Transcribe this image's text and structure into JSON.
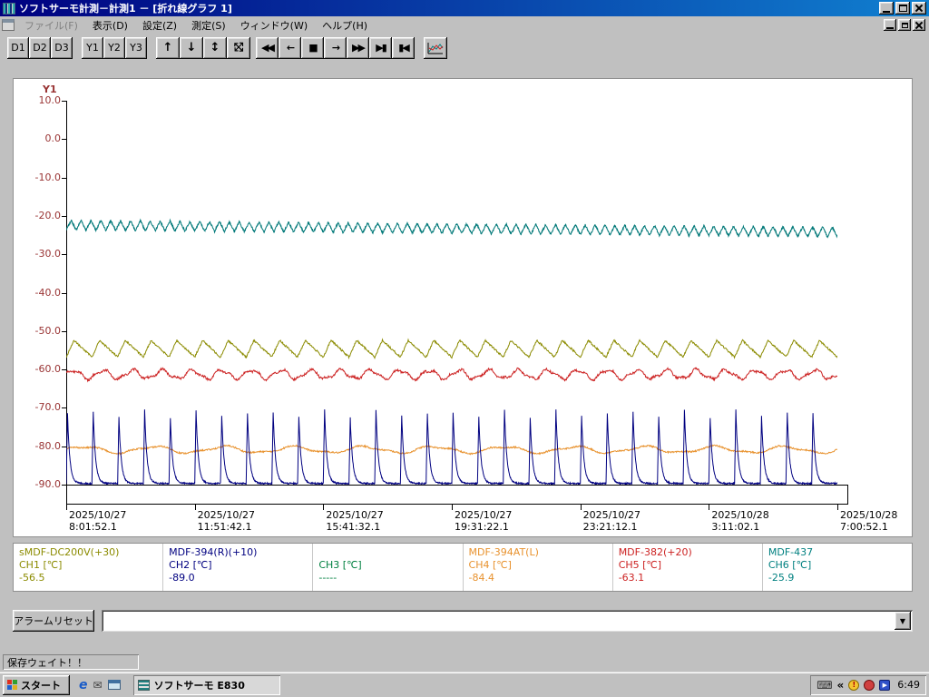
{
  "window": {
    "title": "ソフトサーモ計測－計測1 － [折れ線グラフ 1]"
  },
  "menu": {
    "items": [
      {
        "label": "ファイル(F)",
        "disabled": true
      },
      {
        "label": "表示(D)",
        "disabled": false
      },
      {
        "label": "設定(Z)",
        "disabled": false
      },
      {
        "label": "測定(S)",
        "disabled": false
      },
      {
        "label": "ウィンドウ(W)",
        "disabled": false
      },
      {
        "label": "ヘルプ(H)",
        "disabled": false
      }
    ]
  },
  "toolbar": {
    "d_buttons": [
      "D1",
      "D2",
      "D3"
    ],
    "y_buttons": [
      "Y1",
      "Y2",
      "Y3"
    ],
    "arrow_buttons": [
      {
        "name": "scroll-up-button",
        "glyph": "↑"
      },
      {
        "name": "scroll-down-button",
        "glyph": "↓"
      },
      {
        "name": "fit-vertical-button",
        "glyph": "↕"
      },
      {
        "name": "fit-all-button",
        "glyph": [
          "⤡",
          "⤢"
        ]
      }
    ],
    "media_buttons": [
      {
        "name": "rewind-button",
        "glyph": "◀◀"
      },
      {
        "name": "step-back-button",
        "glyph": "←"
      },
      {
        "name": "stop-button",
        "glyph": "■"
      },
      {
        "name": "step-forward-button",
        "glyph": "→"
      },
      {
        "name": "fast-forward-button",
        "glyph": "▶▶"
      },
      {
        "name": "skip-to-end-button",
        "glyph": "▶▮"
      },
      {
        "name": "skip-to-start-button",
        "glyph": "▮◀"
      }
    ]
  },
  "icons": {
    "dropdown_arrow": "▼",
    "tray_chevron": "«",
    "ie": "e",
    "mail": "✉",
    "keyboard": "⌨",
    "player_play": "▶",
    "warning": "!"
  },
  "chart_data": {
    "type": "line",
    "axis_label": "Y1",
    "ylim": [
      -90,
      10
    ],
    "yticks": [
      "10.0",
      "0.0",
      "-10.0",
      "-20.0",
      "-30.0",
      "-40.0",
      "-50.0",
      "-60.0",
      "-70.0",
      "-80.0",
      "-90.0"
    ],
    "ytick_values": [
      10,
      0,
      -10,
      -20,
      -30,
      -40,
      -50,
      -60,
      -70,
      -80,
      -90
    ],
    "x_ticks": [
      {
        "date": "2025/10/27",
        "time": "8:01:52.1"
      },
      {
        "date": "2025/10/27",
        "time": "11:51:42.1"
      },
      {
        "date": "2025/10/27",
        "time": "15:41:32.1"
      },
      {
        "date": "2025/10/27",
        "time": "19:31:22.1"
      },
      {
        "date": "2025/10/27",
        "time": "23:21:12.1"
      },
      {
        "date": "2025/10/28",
        "time": "3:11:02.1"
      },
      {
        "date": "2025/10/28",
        "time": "7:00:52.1"
      }
    ],
    "series": [
      {
        "channel": "CH6",
        "label": "MDF-437",
        "color": "#007878",
        "waveform": "zigzag",
        "base": -22.4,
        "amp": 1.3,
        "cycles": 78,
        "drift": -1.8,
        "noise": 0.5,
        "current": -25.9
      },
      {
        "channel": "CH1",
        "label": "sMDF-DC200V(+30)",
        "color": "#8b8b00",
        "waveform": "fin",
        "base": -54.6,
        "amp": 2.2,
        "cycles": 30,
        "rise": 0.3,
        "noise": 0.5,
        "current": -56.5
      },
      {
        "channel": "CH5",
        "label": "MDF-382(+20)",
        "color": "#cc2222",
        "waveform": "wave",
        "base": -61.3,
        "amp": 1.1,
        "cycles": 26,
        "noise": 0.6,
        "current": -63.1
      },
      {
        "channel": "CH4",
        "label": "MDF-394AT(L)",
        "color": "#e8922e",
        "waveform": "wave",
        "base": -80.9,
        "amp": 0.8,
        "cycles": 11,
        "noise": 0.4,
        "current": -84.4
      },
      {
        "channel": "CH2",
        "label": "MDF-394(R)(+10)",
        "color": "#000080",
        "waveform": "spikes",
        "base": -89.7,
        "peak": -71.5,
        "cycles": 30,
        "noise": 0.35,
        "current": -89.0
      },
      {
        "channel": "CH3",
        "label": "",
        "color": "#008040",
        "waveform": "none",
        "current": null
      }
    ]
  },
  "legend": {
    "channels": [
      {
        "name": "sMDF-DC200V(+30)",
        "channel": "CH1 [℃]",
        "value": "-56.5",
        "color": "#8b8b00"
      },
      {
        "name": "MDF-394(R)(+10)",
        "channel": "CH2 [℃]",
        "value": "-89.0",
        "color": "#000080"
      },
      {
        "name": "",
        "channel": "CH3 [℃]",
        "value": "-----",
        "color": "#008040"
      },
      {
        "name": "MDF-394AT(L)",
        "channel": "CH4 [℃]",
        "value": "-84.4",
        "color": "#e8922e"
      },
      {
        "name": "MDF-382(+20)",
        "channel": "CH5 [℃]",
        "value": "-63.1",
        "color": "#cc2222"
      },
      {
        "name": "MDF-437",
        "channel": "CH6 [℃]",
        "value": "-25.9",
        "color": "#008080"
      }
    ]
  },
  "controls": {
    "alarm_reset_label": "アラームリセット",
    "combo_value": ""
  },
  "status_bar": {
    "text": "保存ウェイト！！"
  },
  "taskbar": {
    "start_label": "スタート",
    "task_button_label": "ソフトサーモ  E830",
    "clock": "6:49"
  }
}
